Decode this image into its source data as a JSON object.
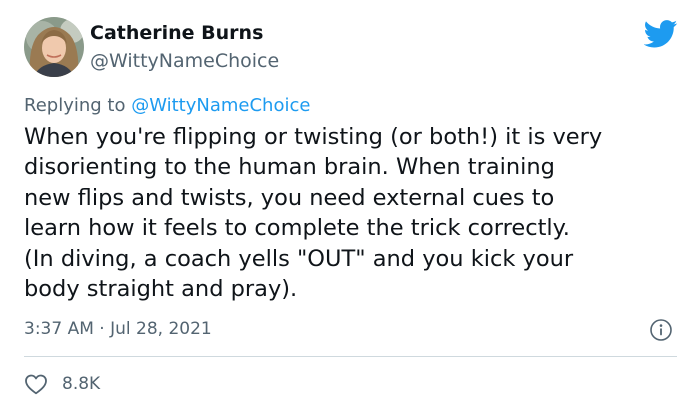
{
  "author": {
    "display_name": "Catherine Burns",
    "handle": "@WittyNameChoice",
    "avatar_icon": "profile-photo"
  },
  "reply": {
    "prefix": "Replying to ",
    "mention": "@WittyNameChoice"
  },
  "tweet": {
    "lines": [
      "When you're flipping or twisting (or both!) it is very",
      "disorienting to the human brain. When training",
      "new flips and twists, you need external cues to",
      "learn how it feels to complete the trick correctly.",
      "(In diving, a coach yells \"OUT\" and you kick your",
      "body straight and pray)."
    ],
    "timestamp": "3:37 AM · Jul 28, 2021"
  },
  "engagement": {
    "likes": "8.8K"
  },
  "icons": {
    "brand": "twitter-bird-icon",
    "info": "info-icon",
    "like": "heart-icon"
  },
  "colors": {
    "brand": "#1d9bf0",
    "text": "#0f1419",
    "secondary": "#536471",
    "divider": "#cfd9de"
  }
}
